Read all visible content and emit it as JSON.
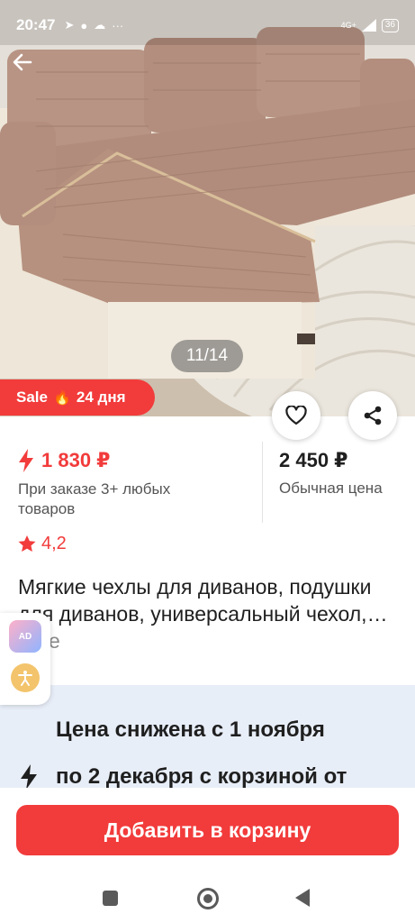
{
  "status_bar": {
    "time": "20:47",
    "network": "4G+",
    "battery": "36",
    "left_icons": [
      "telegram-icon",
      "chat-icon",
      "cloud-icon",
      "more-dots-icon"
    ]
  },
  "hero": {
    "image_counter": "11/14",
    "back_icon": "arrow-left-icon"
  },
  "sale_badge": {
    "label": "Sale",
    "flame": "🔥",
    "days": "24 дня"
  },
  "actions": {
    "favorite_icon": "heart-icon",
    "share_icon": "share-icon"
  },
  "price": {
    "current": "1 830 ₽",
    "current_note": "При заказе 3+ любых товаров",
    "regular": "2 450 ₽",
    "regular_label": "Обычная цена"
  },
  "rating": {
    "value": "4,2"
  },
  "product": {
    "title": "Мягкие чехлы для диванов, подушки для диванов, универсальный чехол,…",
    "more": "Еще"
  },
  "side_widgets": {
    "ad_label": "AD",
    "accessibility_icon": "accessibility-icon"
  },
  "promo": {
    "line1": "Цена снижена с 1 ноября",
    "line2": "по 2 декабря с корзиной от"
  },
  "cart": {
    "button_label": "Добавить в корзину"
  },
  "colors": {
    "accent": "#f23b3b",
    "promo_bg": "#e8eef8"
  }
}
